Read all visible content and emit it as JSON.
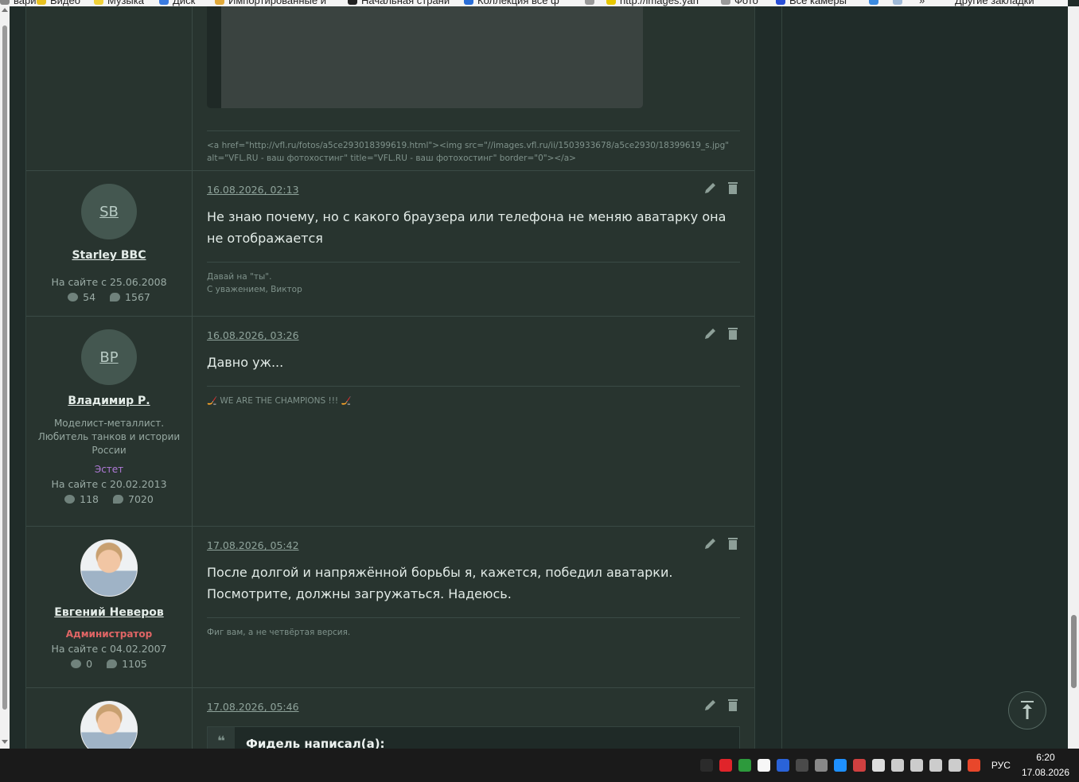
{
  "bookmarks": [
    {
      "label": "вари",
      "color": "#888"
    },
    {
      "label": "Видео",
      "color": "#e8c120"
    },
    {
      "label": "Музыка",
      "color": "#f2d23a"
    },
    {
      "label": "Диск",
      "color": "#3a7be0"
    },
    {
      "label": "Импортированные и",
      "color": "#e1a93a"
    },
    {
      "label": "Начальная страни",
      "color": "#222"
    },
    {
      "label": "Коллекция всё ф",
      "color": "#2a6ed8"
    },
    {
      "label": "",
      "color": "#999"
    },
    {
      "label": "http://images.yan",
      "color": "#e8c800"
    },
    {
      "label": "Фото",
      "color": "#999"
    },
    {
      "label": "Все камеры",
      "color": "#2a4fd8"
    },
    {
      "label": "",
      "color": "#3a8ae0"
    },
    {
      "label": "",
      "color": "#9fbad8"
    },
    {
      "label": "»",
      "color": "transparent"
    },
    {
      "label": "Другие закладки",
      "color": "transparent"
    }
  ],
  "posts": [
    {
      "signature_html_line1": "<a href=\"http://vfl.ru/fotos/a5ce293018399619.html\"><img src=\"//images.vfl.ru/ii/1503933678/a5ce2930/18399619_s.jpg\"",
      "signature_html_line2": "alt=\"VFL.RU - ваш фотохостинг\" title=\"VFL.RU - ваш фотохостинг\" border=\"0\"></a>"
    },
    {
      "avatar_initials": "SB",
      "username": "Starley BBC",
      "since": "На сайте с 25.06.2008",
      "stat1": "54",
      "stat2": "1567",
      "date": "16.08.2026, 02:13",
      "text": "Не знаю почему, но с какого браузера или телефона не меняю аватарку она не отображается",
      "sig1": "Давай на \"ты\".",
      "sig2": "С уважением, Виктор"
    },
    {
      "avatar_initials": "BP",
      "username": "Владимир Р.",
      "title": "Моделист-металлист. Любитель танков и истории России",
      "rank": "Эстет",
      "since": "На сайте с 20.02.2013",
      "stat1": "118",
      "stat2": "7020",
      "date": "16.08.2026, 03:26",
      "text": "Давно уж...",
      "sig1": "🏒 WE ARE THE CHAMPIONS !!! 🏒"
    },
    {
      "username": "Евгений Неверов",
      "rank": "Администратор",
      "since": "На сайте с 04.02.2007",
      "stat1": "0",
      "stat2": "1105",
      "date": "17.08.2026, 05:42",
      "text": "После долгой и напряжённой борьбы я, кажется, победил аватарки. Посмотрите, должны загружаться. Надеюсь.",
      "sig1": "Фиг вам, а не четвёртая версия."
    },
    {
      "date": "17.08.2026, 05:46",
      "quote_title": "Фидель написал(а):"
    }
  ],
  "taskbar": {
    "lang": "РУС",
    "time": "6:20",
    "date": "17.08.2026",
    "tray_colors": [
      "#2b2b2b",
      "#e0242a",
      "#2d9a3c",
      "#f7f7f7",
      "#2a63d8",
      "#4a4a4a",
      "#888",
      "#1e90ff",
      "#d04040",
      "#ddd",
      "#ccc",
      "#ccc",
      "#ccc",
      "#ccc",
      "#e8472b"
    ]
  }
}
